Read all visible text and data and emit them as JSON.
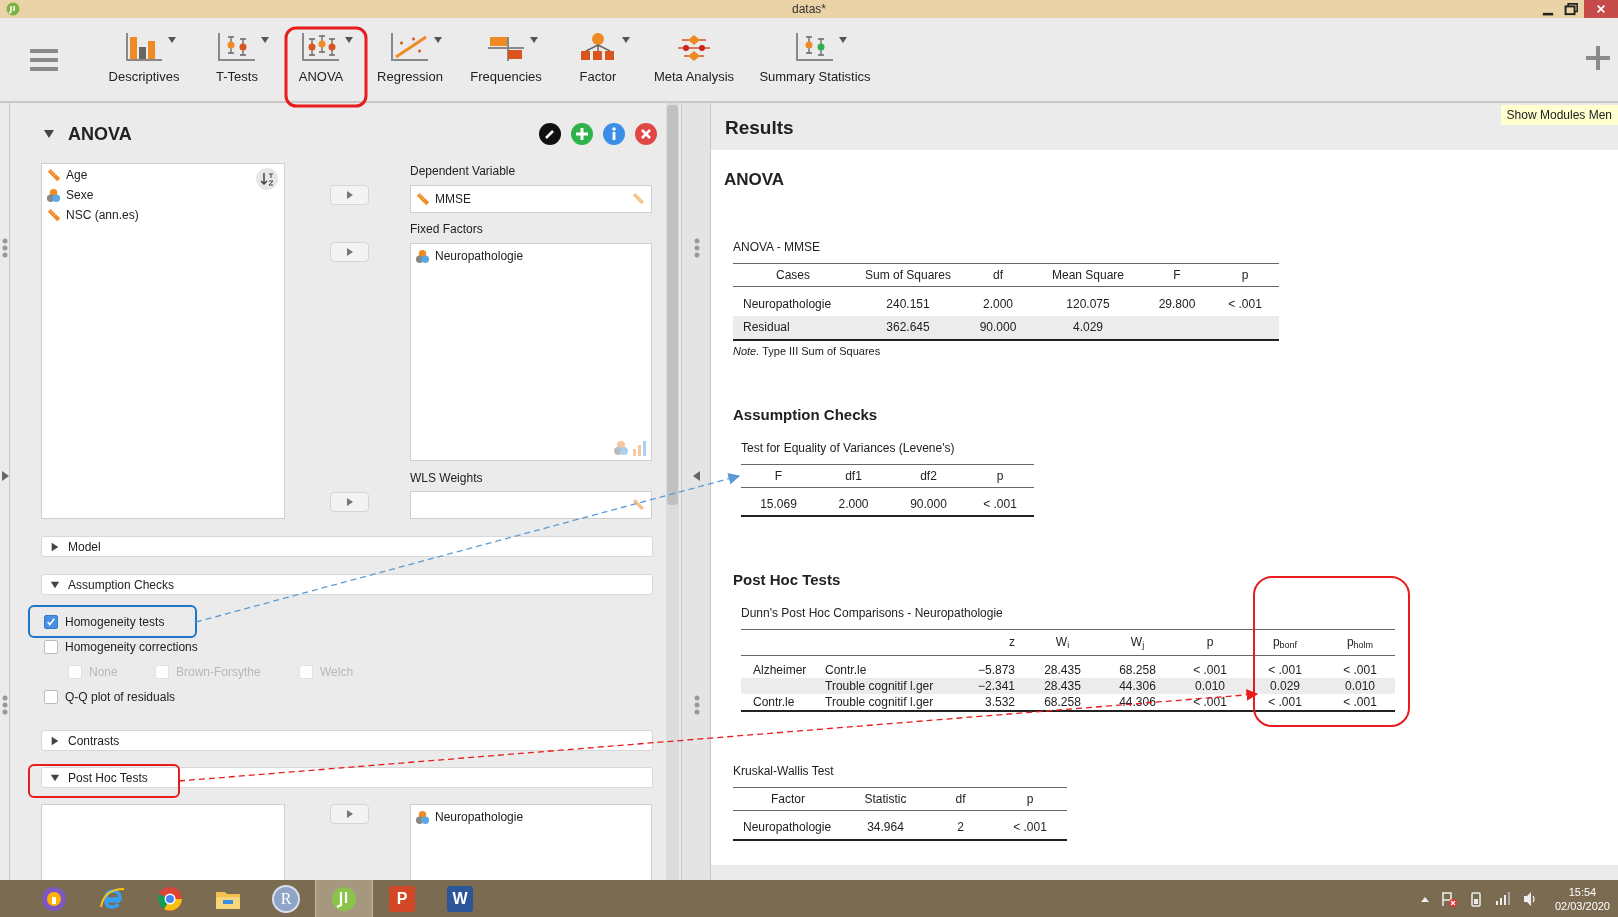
{
  "window": {
    "title": "datas*"
  },
  "toolbar": {
    "modules": [
      {
        "label": "Descriptives",
        "kind": "descriptives",
        "has_menu": true
      },
      {
        "label": "T-Tests",
        "kind": "ttest",
        "has_menu": true
      },
      {
        "label": "ANOVA",
        "kind": "anova",
        "has_menu": true
      },
      {
        "label": "Regression",
        "kind": "regression",
        "has_menu": true
      },
      {
        "label": "Frequencies",
        "kind": "frequencies",
        "has_menu": true
      },
      {
        "label": "Factor",
        "kind": "factor",
        "has_menu": true
      },
      {
        "label": "Meta Analysis",
        "kind": "meta",
        "has_menu": false
      },
      {
        "label": "Summary Statistics",
        "kind": "summary",
        "has_menu": true
      }
    ],
    "tooltip": "Show Modules Men"
  },
  "analysis": {
    "title": "ANOVA",
    "expanded": true,
    "variables": [
      {
        "name": "Age",
        "kind": "scale"
      },
      {
        "name": "Sexe",
        "kind": "nominal"
      },
      {
        "name": "NSC (ann.es)",
        "kind": "scale"
      }
    ],
    "dependent_variable": {
      "label": "Dependent Variable",
      "items": [
        {
          "name": "MMSE",
          "kind": "scale"
        }
      ]
    },
    "fixed_factors": {
      "label": "Fixed Factors",
      "items": [
        {
          "name": "Neuropathologie",
          "kind": "nominal"
        }
      ]
    },
    "wls_weights": {
      "label": "WLS Weights"
    },
    "sections": [
      {
        "title": "Model",
        "expanded": false
      },
      {
        "title": "Assumption Checks",
        "expanded": true,
        "options": [
          {
            "label": "Homogeneity tests",
            "checked": true,
            "disabled": false
          },
          {
            "label": "Homogeneity corrections",
            "checked": false,
            "disabled": false,
            "children": [
              {
                "label": "None",
                "checked": false,
                "disabled": true
              },
              {
                "label": "Brown-Forsythe",
                "checked": false,
                "disabled": true
              },
              {
                "label": "Welch",
                "checked": false,
                "disabled": true
              }
            ]
          },
          {
            "label": "Q-Q plot of residuals",
            "checked": false,
            "disabled": false
          }
        ]
      },
      {
        "title": "Contrasts",
        "expanded": false
      },
      {
        "title": "Post Hoc Tests",
        "expanded": true,
        "assigned": [
          {
            "name": "Neuropathologie",
            "kind": "nominal"
          }
        ]
      }
    ]
  },
  "results": {
    "title": "Results",
    "analysis_title": "ANOVA",
    "blocks": [
      {
        "kind": "table",
        "title": "ANOVA - MMSE",
        "columns": [
          "Cases",
          "Sum of Squares",
          "df",
          "Mean Square",
          "F",
          "p"
        ],
        "rows": [
          {
            "cells": [
              "Neuropathologie",
              "240.151",
              "2.000",
              "120.075",
              "29.800",
              "< .001"
            ]
          },
          {
            "cells": [
              "Residual",
              "362.645",
              "90.000",
              "4.029"
            ]
          }
        ],
        "note": "*Note.* Type III Sum of Squares"
      },
      {
        "kind": "table",
        "heading": "Assumption Checks",
        "title": "Test for Equality of Variances (Levene's)",
        "columns": [
          "F",
          "df1",
          "df2",
          "p"
        ],
        "rows": [
          {
            "cells": [
              "15.069",
              "2.000",
              "90.000",
              "< .001"
            ]
          }
        ]
      },
      {
        "kind": "comparisons",
        "heading": "Post Hoc Tests",
        "title": "Dunn's Post Hoc Comparisons - Neuropathologie",
        "columns": [
          "z",
          "W$_{i}$",
          "W$_{j}$",
          "p",
          "p$_{bonf}$",
          "p$_{holm}$"
        ],
        "rows": [
          {
            "group": "Alzheimer",
            "comparison": "Contr.le",
            "values": [
              "−5.873",
              "28.435",
              "68.258",
              "< .001",
              "< .001",
              "< .001"
            ]
          },
          {
            "comparison": "Trouble cognitif l.ger",
            "values": [
              "−2.341",
              "28.435",
              "44.306",
              "0.010",
              "0.029",
              "0.010"
            ]
          },
          {
            "group": "Contr.le",
            "comparison": "Trouble cognitif l.ger",
            "values": [
              "3.532",
              "68.258",
              "44.306",
              "< .001",
              "< .001",
              "< .001"
            ]
          }
        ]
      },
      {
        "kind": "table",
        "title": "Kruskal-Wallis Test",
        "columns": [
          "Factor",
          "Statistic",
          "df",
          "p"
        ],
        "rows": [
          {
            "cells": [
              "Neuropathologie",
              "34.964",
              "2",
              "< .001"
            ]
          }
        ]
      }
    ]
  },
  "taskbar": {
    "apps": [
      {
        "kind": "shield",
        "active": false
      },
      {
        "kind": "browser",
        "active": false
      },
      {
        "kind": "globe",
        "active": false
      },
      {
        "kind": "folder",
        "active": false
      },
      {
        "kind": "letter",
        "glyph": "R",
        "active": false
      },
      {
        "kind": "jasp",
        "active": true
      },
      {
        "kind": "slides",
        "glyph": "P",
        "active": false
      },
      {
        "kind": "document",
        "glyph": "W",
        "active": false
      }
    ],
    "time": "15:54",
    "date": "02/03/2020"
  }
}
